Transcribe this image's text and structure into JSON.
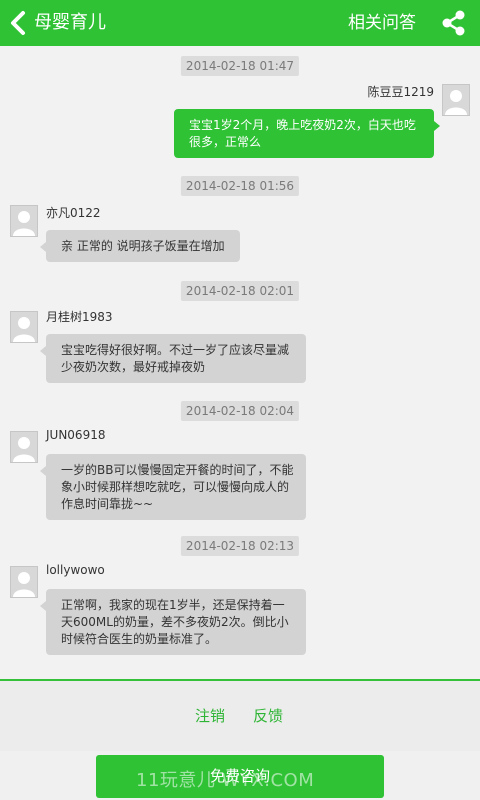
{
  "header": {
    "title": "母婴育儿",
    "related_label": "相关问答",
    "back_icon": "chevron-left-icon",
    "share_icon": "share-icon"
  },
  "colors": {
    "brand_green": "#2fc235",
    "bubble_gray": "#d3d3d3",
    "background": "#f0f0f0"
  },
  "messages": [
    {
      "timestamp": "2014-02-18 01:47",
      "sender": "陈豆豆1219",
      "text": "宝宝1岁2个月，晚上吃夜奶2次，白天也吃很多，正常么",
      "side": "right"
    },
    {
      "timestamp": "2014-02-18 01:56",
      "sender": "亦凡0122",
      "text": "亲 正常的 说明孩子饭量在增加",
      "side": "left"
    },
    {
      "timestamp": "2014-02-18 02:01",
      "sender": "月桂树1983",
      "text": "宝宝吃得好很好啊。不过一岁了应该尽量减少夜奶次数，最好戒掉夜奶",
      "side": "left"
    },
    {
      "timestamp": "2014-02-18 02:04",
      "sender": "JUN06918",
      "text": "一岁的BB可以慢慢固定开餐的时间了，不能象小时候那样想吃就吃，可以慢慢向成人的作息时间靠拢~~",
      "side": "left"
    },
    {
      "timestamp": "2014-02-18 02:13",
      "sender": "lollywowo",
      "text": "正常啊，我家的现在1岁半，还是保持着一天600ML的奶量，差不多夜奶2次。倒比小时候符合医生的奶量标准了。",
      "side": "left"
    }
  ],
  "actions": {
    "cancel_label": "注销",
    "feedback_label": "反馈"
  },
  "footer": {
    "consult_label": "免费咨询",
    "watermark": "11玩意儿 WYX.COM"
  }
}
